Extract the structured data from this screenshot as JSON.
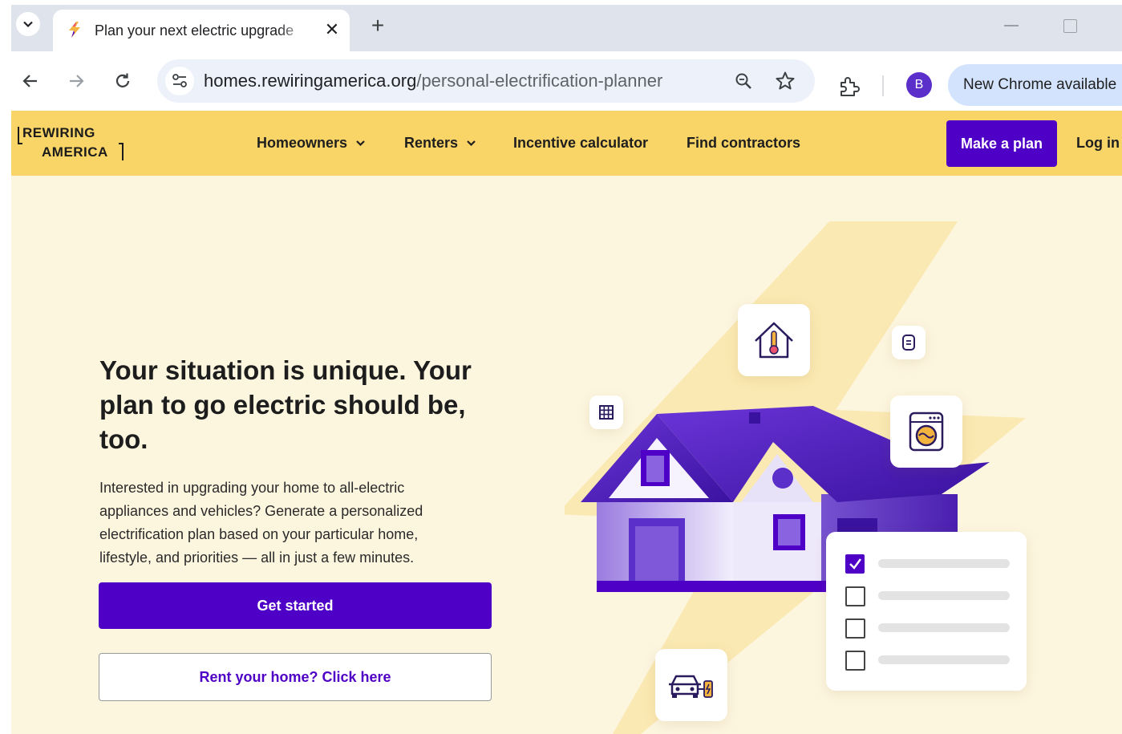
{
  "browser": {
    "tab": {
      "title": "Plan your next electric upgrade",
      "close_glyph": "✕"
    },
    "new_tab_glyph": "+",
    "address_bar": {
      "domain": "homes.rewiringamerica.org",
      "path": "/personal-electrification-planner"
    },
    "profile_initial": "B",
    "update_chip": "New Chrome available",
    "icons": [
      "tab-search-icon",
      "back-icon",
      "forward-icon",
      "reload-icon",
      "site-info-icon",
      "zoom-icon",
      "bookmark-star-icon",
      "extensions-icon",
      "minimize-icon",
      "maximize-icon"
    ]
  },
  "site": {
    "logo": {
      "line1": "REWIRING",
      "line2": "AMERICA"
    },
    "nav": [
      {
        "label": "Homeowners",
        "has_dropdown": true
      },
      {
        "label": "Renters",
        "has_dropdown": true
      },
      {
        "label": "Incentive calculator",
        "has_dropdown": false
      },
      {
        "label": "Find contractors",
        "has_dropdown": false
      }
    ],
    "cta": "Make a plan",
    "login": "Log in",
    "colors": {
      "header_bg": "#f9d466",
      "page_bg": "#fdf6df",
      "brand_purple": "#4f00c6"
    }
  },
  "hero": {
    "title": "Your situation is unique. Your plan to go electric should be, too.",
    "body": "Interested in upgrading your home to all-electric appliances and vehicles? Generate a personalized electrification plan based on your particular home, lifestyle, and priorities — all in just a few minutes.",
    "primary_button": "Get started",
    "secondary_button": "Rent your home? Click here"
  },
  "illustration": {
    "icons": [
      "house-icon",
      "heat-pump-icon",
      "water-heater-icon",
      "solar-panel-icon",
      "dryer-icon",
      "ev-charger-icon"
    ],
    "checklist": [
      {
        "checked": true
      },
      {
        "checked": false
      },
      {
        "checked": false
      },
      {
        "checked": false
      }
    ]
  }
}
